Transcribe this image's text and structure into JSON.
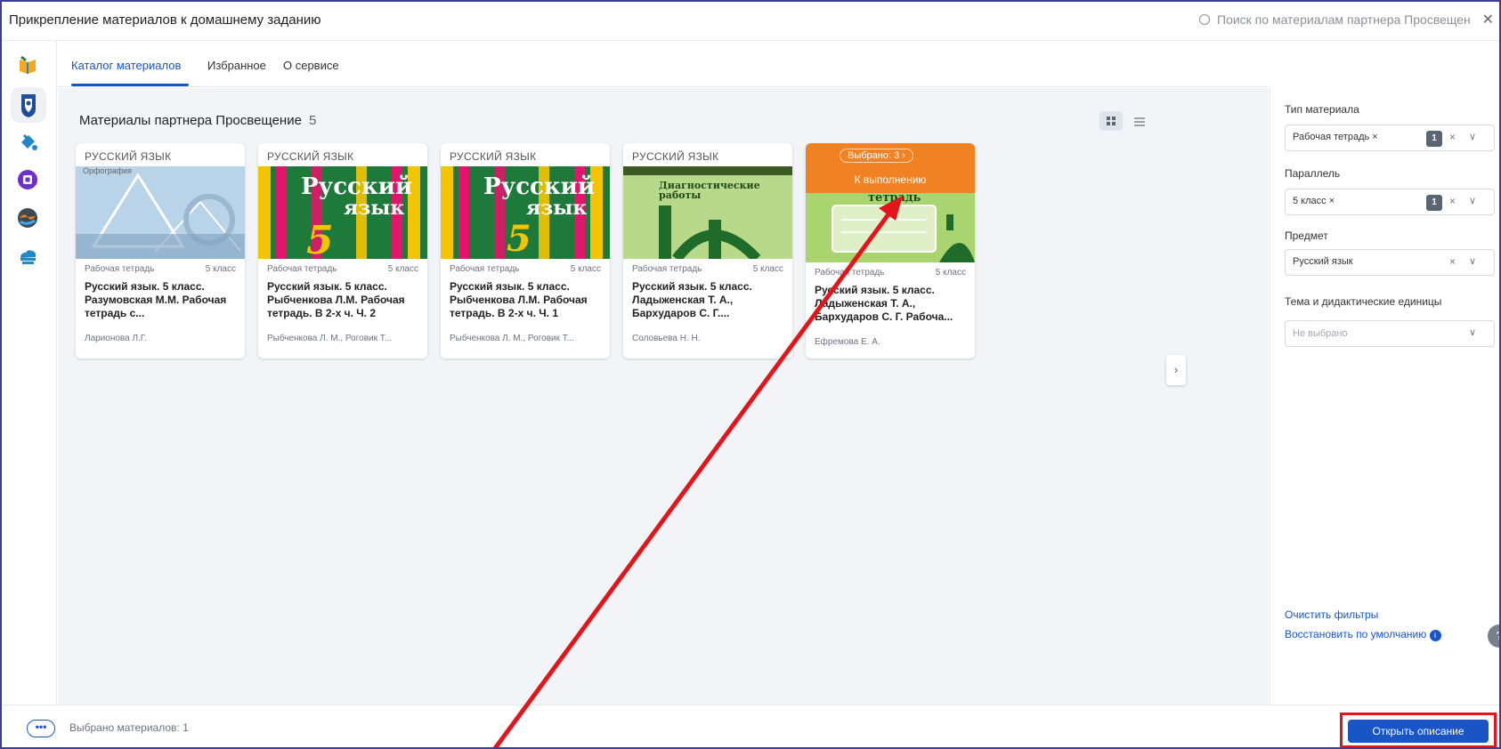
{
  "window": {
    "title": "Прикрепление материалов к домашнему заданию",
    "close_icon": "close-icon"
  },
  "search": {
    "placeholder": "Поиск по материалам партнера Просвещен"
  },
  "rail": {
    "icons": [
      "book-icon",
      "shield-icon",
      "paint-bucket-icon",
      "app-icon",
      "globe-icon",
      "cloud-library-icon"
    ]
  },
  "tabs": [
    {
      "label": "Каталог материалов",
      "active": true
    },
    {
      "label": "Избранное",
      "active": false
    },
    {
      "label": "О сервисе",
      "active": false
    }
  ],
  "main": {
    "heading": "Материалы партнера Просвещение",
    "count": "5"
  },
  "cards": [
    {
      "subject": "РУССКИЙ ЯЗЫК",
      "type": "Рабочая тетрадь",
      "grade": "5 класс",
      "title": "Русский язык. 5 класс. Разумовская М.М. Рабочая тетрадь с...",
      "authors": "Ларионова Л.Г.",
      "cover_heading": "Орфография"
    },
    {
      "subject": "РУССКИЙ ЯЗЫК",
      "type": "Рабочая тетрадь",
      "grade": "5 класс",
      "title": "Русский язык. 5 класс. Рыбченкова Л.М. Рабочая тетрадь. В 2-х ч. Ч. 2",
      "authors": "Рыбченкова Л. М., Роговик Т...",
      "cover_line1": "Русский",
      "cover_line2": "язык",
      "cover_num": "5"
    },
    {
      "subject": "РУССКИЙ ЯЗЫК",
      "type": "Рабочая тетрадь",
      "grade": "5 класс",
      "title": "Русский язык. 5 класс. Рыбченкова Л.М. Рабочая тетрадь. В 2-х ч. Ч. 1",
      "authors": "Рыбченкова Л. М., Роговик Т...",
      "cover_line1": "Русский",
      "cover_line2": "язык",
      "cover_num": "5"
    },
    {
      "subject": "РУССКИЙ ЯЗЫК",
      "type": "Рабочая тетрадь",
      "grade": "5 класс",
      "title": "Русский язык. 5 класс. Ладыженская Т. А., Бархударов С. Г....",
      "authors": "Соловьева Н. Н.",
      "cover_title": "Диагностические работы"
    },
    {
      "type": "Рабочая тетрадь",
      "grade": "5 класс",
      "title": "Русский язык. 5 класс. Ладыженская Т. А., Бархударов С. Г. Рабоча...",
      "authors": "Ефремова Е. А.",
      "selected_badge": "Выбрано: 3 ›",
      "status": "К выполнению",
      "cover_title": "тетрадь"
    }
  ],
  "filters": {
    "material_type": {
      "label": "Тип материала",
      "chip": "Рабочая тетрадь ×",
      "count": "1"
    },
    "grade": {
      "label": "Параллель",
      "chip": "5 класс ×",
      "count": "1"
    },
    "subject": {
      "label": "Предмет",
      "value": "Русский язык"
    },
    "topic": {
      "label": "Тема и дидактические единицы",
      "placeholder": "Не выбрано"
    },
    "clear_label": "Очистить фильтры",
    "restore_label": "Восстановить по умолчанию"
  },
  "footer": {
    "more_label": "•••",
    "selected_text": "Выбрано материалов: 1",
    "open_button": "Открыть описание"
  },
  "colors": {
    "accent": "#1a55c5",
    "selected_orange": "#f08224",
    "annotation_red": "#e3141a"
  }
}
